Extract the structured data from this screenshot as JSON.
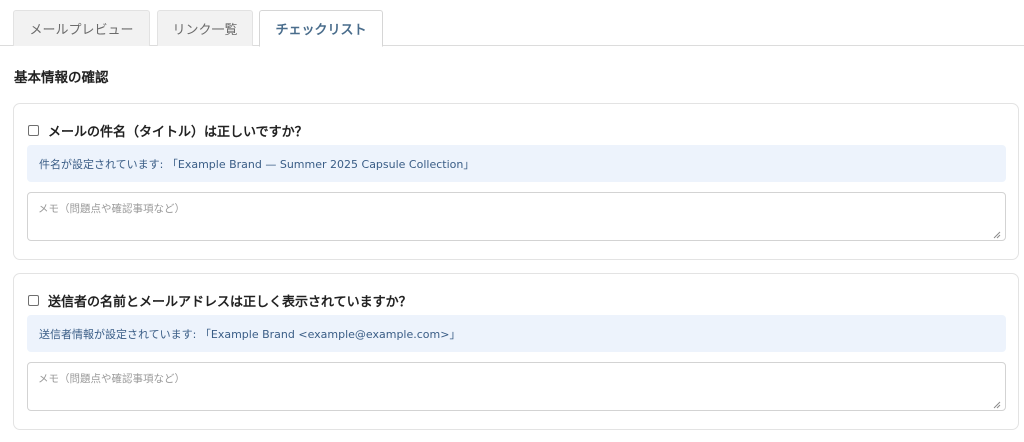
{
  "tabs": [
    {
      "label": "メールプレビュー",
      "active": false
    },
    {
      "label": "リンク一覧",
      "active": false
    },
    {
      "label": "チェックリスト",
      "active": true
    }
  ],
  "section": {
    "title": "基本情報の確認"
  },
  "checklist": [
    {
      "question": "メールの件名（タイトル）は正しいですか？",
      "checked": false,
      "info": "件名が設定されています: 「Example Brand — Summer 2025 Capsule Collection」",
      "memo_value": "",
      "memo_placeholder": "メモ（問題点や確認事項など）"
    },
    {
      "question": "送信者の名前とメールアドレスは正しく表示されていますか？",
      "checked": false,
      "info": "送信者情報が設定されています: 「Example Brand <example@example.com>」",
      "memo_value": "",
      "memo_placeholder": "メモ（問題点や確認事項など）"
    }
  ],
  "colors": {
    "accent": "#4a6d8c",
    "info_bg": "#edf3fc",
    "info_text": "#3a5d86"
  }
}
